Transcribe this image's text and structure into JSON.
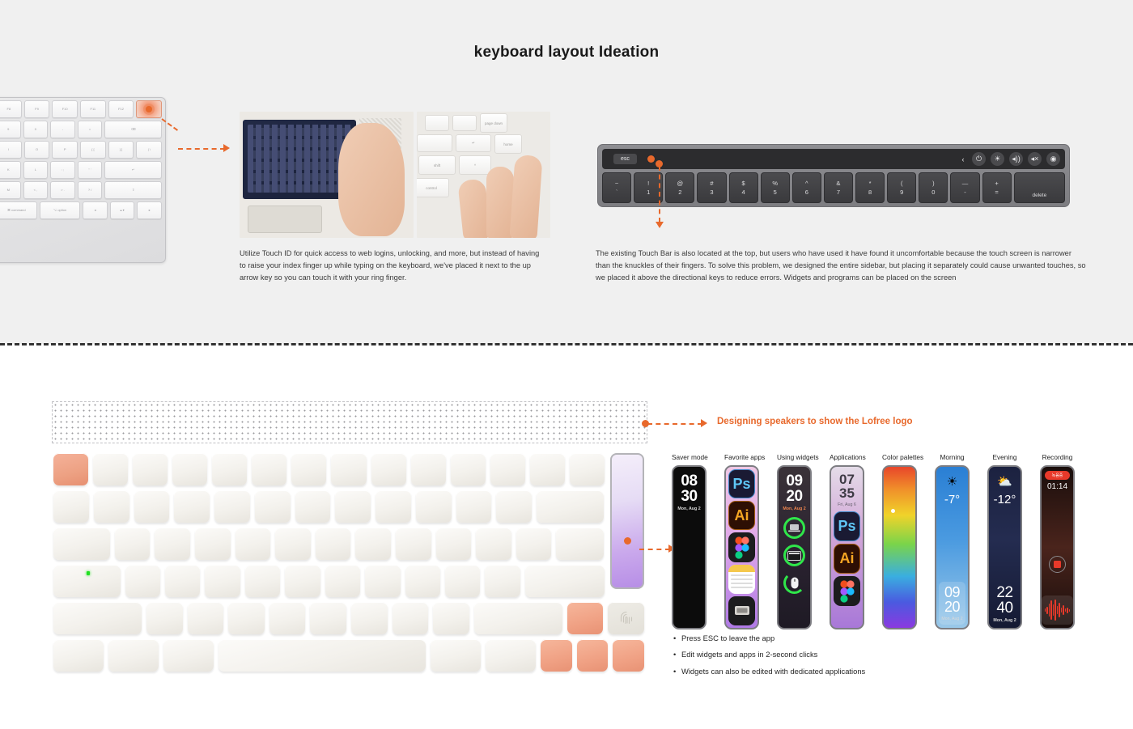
{
  "page": {
    "title": "keyboard layout Ideation"
  },
  "top": {
    "magic_keyboard": {
      "name": "magic-keyboard-photo",
      "function_keys": [
        {
          "top": "◁◁",
          "bottom": "F8"
        },
        {
          "top": "▷▷",
          "bottom": "F9"
        },
        {
          "top": "◁",
          "bottom": "F10"
        },
        {
          "top": "◁)",
          "bottom": "F11"
        },
        {
          "top": "◁))",
          "bottom": "F12"
        }
      ],
      "number_row": [
        {
          "top": "(",
          "bottom": "9"
        },
        {
          "top": ")",
          "bottom": "0"
        },
        {
          "top": "—",
          "bottom": "-"
        },
        {
          "top": "+",
          "bottom": "="
        },
        {
          "top": "",
          "bottom": "⌫"
        }
      ],
      "row_q": [
        "I",
        "O",
        "P",
        "{ [",
        "} ]",
        "| \\"
      ],
      "row_a": [
        "K",
        "L",
        ": ;",
        "\" '",
        "↵"
      ],
      "row_z": [
        "M",
        "< ,",
        "> .",
        "? /",
        "⇧"
      ],
      "row_mod": [
        "⌘ command",
        "⌥ option",
        "◂",
        "▴ ▾",
        "▸"
      ],
      "touch_id_label": "touch-id-key"
    },
    "photos": {
      "left_caption_name": "photo-laptop-hand",
      "right_caption_name": "photo-fingers-arrowkeys"
    },
    "touchbar": {
      "esc_label": "esc",
      "control_icons": [
        "chevron-left-icon",
        "power-icon",
        "brightness-icon",
        "volume-up-icon",
        "volume-mute-icon",
        "siri-icon"
      ],
      "control_glyphs": [
        "‹",
        "⏻",
        "☀",
        "◂))",
        "◂×",
        "◉"
      ],
      "keys": [
        {
          "top": "~",
          "bottom": "`"
        },
        {
          "top": "!",
          "bottom": "1"
        },
        {
          "top": "@",
          "bottom": "2"
        },
        {
          "top": "#",
          "bottom": "3"
        },
        {
          "top": "$",
          "bottom": "4"
        },
        {
          "top": "%",
          "bottom": "5"
        },
        {
          "top": "^",
          "bottom": "6"
        },
        {
          "top": "&",
          "bottom": "7"
        },
        {
          "top": "*",
          "bottom": "8"
        },
        {
          "top": "(",
          "bottom": "9"
        },
        {
          "top": ")",
          "bottom": "0"
        },
        {
          "top": "—",
          "bottom": "-"
        },
        {
          "top": "+",
          "bottom": "="
        }
      ],
      "delete_label": "delete"
    },
    "caption_left": "Utilize Touch ID for quick access to web logins, unlocking, and more, but instead of having to raise your index finger up while typing on the keyboard, we've placed it next to the up arrow key so you can touch it with your ring finger.",
    "caption_right": "The existing Touch Bar is also located at the top, but users who have used it have found it uncomfortable because the touch screen is narrower than the knuckles of their fingers. To solve this problem, we designed the entire sidebar, but placing it separately could cause unwanted touches, so we placed it above the directional keys to reduce errors. Widgets and programs can be placed on the screen"
  },
  "bottom": {
    "speaker_note": "Designing speakers to show the Lofree logo",
    "bullets": [
      "Press ESC to leave the app",
      "Edit widgets and apps in 2-second clicks",
      "Widgets can also be edited with dedicated applications"
    ],
    "widgets": [
      {
        "label": "Saver mode",
        "time_top": "08",
        "time_bottom": "30",
        "date": "Mon, Aug 2"
      },
      {
        "label": "Favorite apps",
        "apps": [
          "Ps",
          "Ai",
          "Figma",
          "Notes",
          "Finder"
        ]
      },
      {
        "label": "Using widgets",
        "time_top": "09",
        "time_bottom": "20",
        "date": "Mon, Aug 2",
        "rings": [
          "laptop-icon",
          "window-icon",
          "mouse-icon"
        ]
      },
      {
        "label": "Applications",
        "time_top": "07",
        "time_bottom": "35",
        "date": "Fri, Aug 6",
        "apps": [
          "Ps",
          "Ai",
          "Figma"
        ]
      },
      {
        "label": "Color palettes"
      },
      {
        "label": "Morning",
        "icon": "sun-icon",
        "temperature": "-7°",
        "time_top": "09",
        "time_bottom": "20",
        "date": "Mon, Aug 2"
      },
      {
        "label": "Evening",
        "icon": "sun-cloud-icon",
        "temperature": "-12°",
        "time_top": "22",
        "time_bottom": "40",
        "date": "Mon, Aug 2"
      },
      {
        "label": "Recording",
        "badge": "녹음중",
        "timer": "01:14",
        "stop": "stop-button"
      }
    ]
  },
  "colors": {
    "accent_orange": "#e8692c",
    "top_bg": "#f0f0f0",
    "key_orange": "#f0a184",
    "led_green": "#23e023"
  }
}
